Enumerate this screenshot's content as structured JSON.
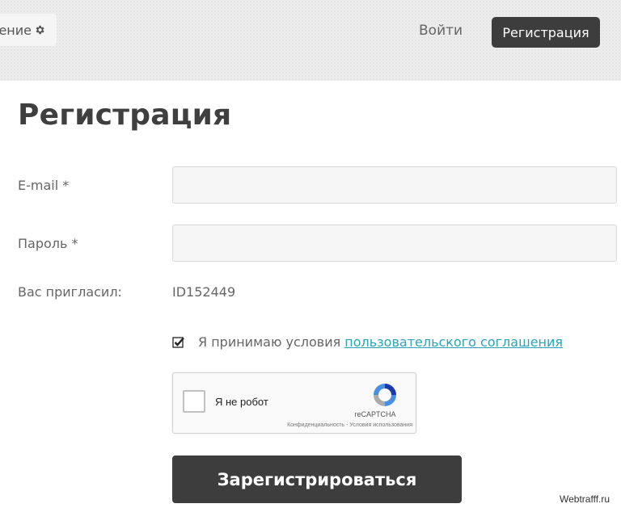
{
  "header": {
    "settings_label": "ение",
    "login_label": "Войти",
    "register_label": "Регистрация"
  },
  "title": "Регистрация",
  "form": {
    "email": {
      "label": "E-mail *",
      "value": "",
      "placeholder": ""
    },
    "password": {
      "label": "Пароль *",
      "value": "",
      "placeholder": ""
    },
    "inviter": {
      "label": "Вас пригласил:",
      "value": "ID152449"
    },
    "terms": {
      "checked": true,
      "text": "Я принимаю условия",
      "link_text": "пользовательского соглашения"
    },
    "captcha": {
      "label": "Я не робот",
      "brand": "reCAPTCHA",
      "links": "Конфиденциальность - Условия использования"
    },
    "submit_label": "Зарегистрироваться"
  },
  "watermark": "Webtrafff.ru",
  "colors": {
    "dark_button": "#3d3d3d",
    "link": "#2aa4b8",
    "header_bg": "#ececec"
  },
  "icons": {
    "settings": "gear-icon",
    "terms_check": "check-icon",
    "captcha": "recaptcha-logo-icon"
  }
}
